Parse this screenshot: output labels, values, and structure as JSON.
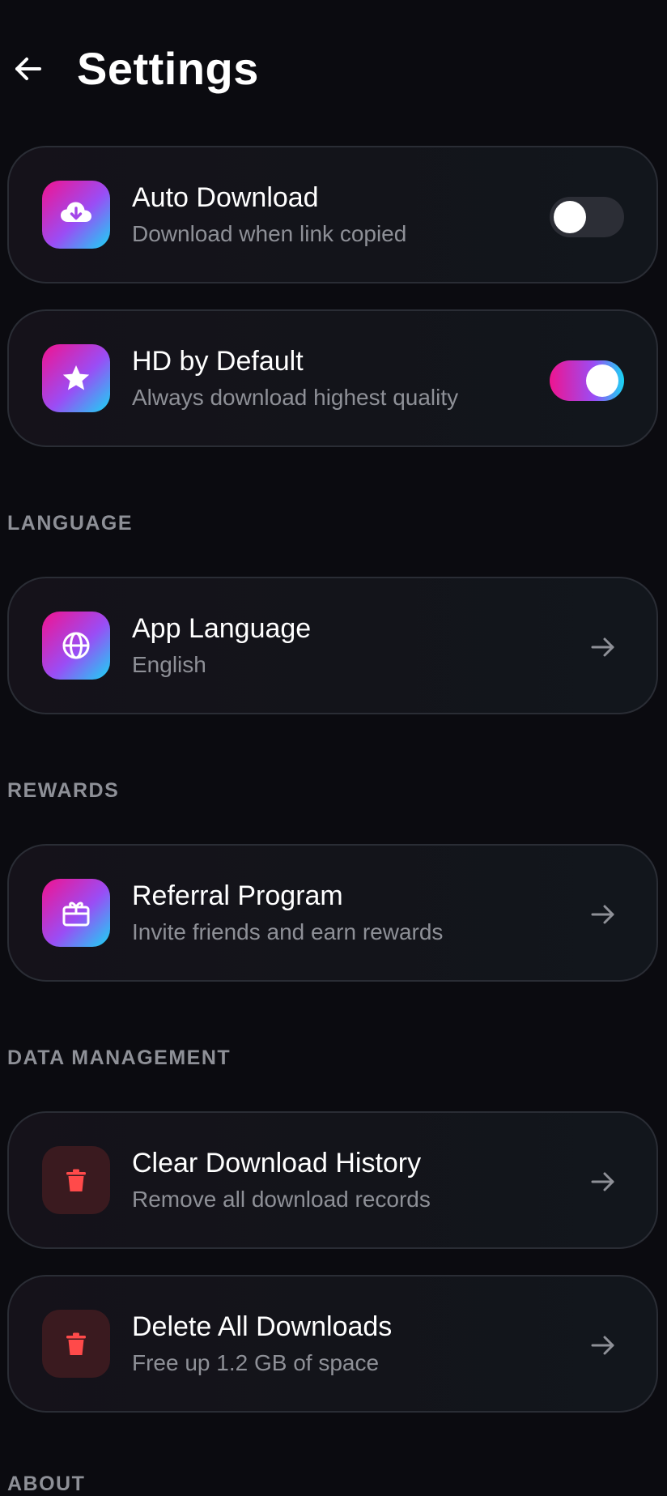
{
  "header": {
    "title": "Settings",
    "back_icon": "back-arrow-icon"
  },
  "settings": {
    "auto_download": {
      "title": "Auto Download",
      "subtitle": "Download when link copied",
      "icon": "cloud-download-icon",
      "enabled": false
    },
    "hd_default": {
      "title": "HD by Default",
      "subtitle": "Always download highest quality",
      "icon": "star-icon",
      "enabled": true
    }
  },
  "sections": {
    "language": "LANGUAGE",
    "rewards": "REWARDS",
    "data_management": "DATA MANAGEMENT",
    "about": "ABOUT"
  },
  "language": {
    "title": "App Language",
    "subtitle": "English",
    "icon": "globe-icon"
  },
  "rewards": {
    "title": "Referral Program",
    "subtitle": "Invite friends and earn rewards",
    "icon": "gift-icon"
  },
  "data": {
    "clear_history": {
      "title": "Clear Download History",
      "subtitle": "Remove all download records",
      "icon": "trash-icon"
    },
    "delete_all": {
      "title": "Delete All Downloads",
      "subtitle": "Free up 1.2 GB of space",
      "icon": "trash-icon"
    }
  },
  "colors": {
    "background": "#0b0b10",
    "accent_pink": "#f2128f",
    "accent_purple": "#9a4df5",
    "accent_cyan": "#18d6f4",
    "danger": "#ff4a4a",
    "muted_text": "#8e9097"
  }
}
